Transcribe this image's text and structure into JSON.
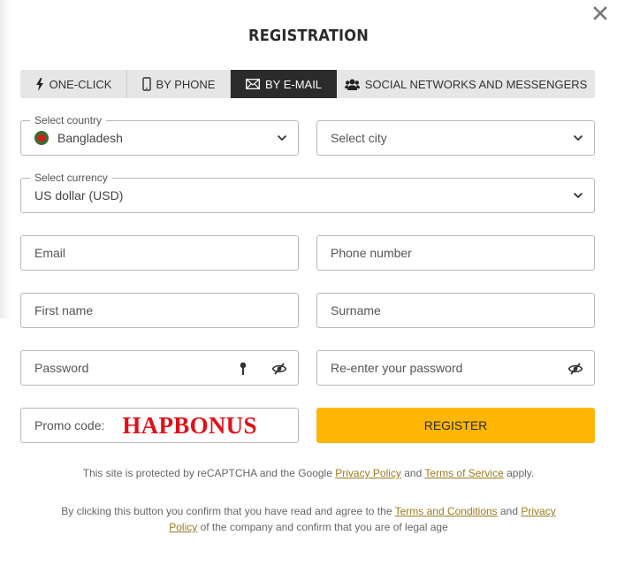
{
  "dialog": {
    "title": "REGISTRATION",
    "close_icon": "close-icon"
  },
  "tabs": [
    {
      "label": "ONE-CLICK",
      "icon": "lightning-icon",
      "active": false
    },
    {
      "label": "BY PHONE",
      "icon": "phone-icon",
      "active": false
    },
    {
      "label": "BY E-MAIL",
      "icon": "envelope-icon",
      "active": true
    },
    {
      "label": "SOCIAL NETWORKS AND MESSENGERS",
      "icon": "users-icon",
      "active": false
    }
  ],
  "form": {
    "country": {
      "legend": "Select country",
      "value": "Bangladesh",
      "flag_colors": {
        "field": "#3d6b2e",
        "disc": "#e0141e"
      }
    },
    "city": {
      "placeholder": "Select city"
    },
    "currency": {
      "legend": "Select currency",
      "value": "US dollar (USD)"
    },
    "email": {
      "placeholder": "Email"
    },
    "phone": {
      "placeholder": "Phone number"
    },
    "first_name": {
      "placeholder": "First name"
    },
    "surname": {
      "placeholder": "Surname"
    },
    "password": {
      "placeholder": "Password"
    },
    "password_confirm": {
      "placeholder": "Re-enter your password"
    },
    "promo": {
      "label": "Promo code:",
      "value": "HAPBONUS"
    },
    "register_label": "REGISTER"
  },
  "recaptcha_notice": {
    "prefix": "This site is protected by reCAPTCHA and the Google ",
    "privacy_link": "Privacy Policy",
    "middle": " and ",
    "terms_link": "Terms of Service",
    "suffix": " apply."
  },
  "consent_notice": {
    "prefix": "By clicking this button you confirm that you have read and agree to the ",
    "terms_link": "Terms and Conditions",
    "middle": " and ",
    "privacy_link": "Privacy Policy",
    "suffix": " of the company and confirm that you are of legal age"
  },
  "colors": {
    "accent": "#fdb702",
    "active_tab": "#2b2b2b",
    "tab_bg": "#e6e6e6",
    "promo_text": "#e0101a",
    "link": "#9b7c1f"
  }
}
